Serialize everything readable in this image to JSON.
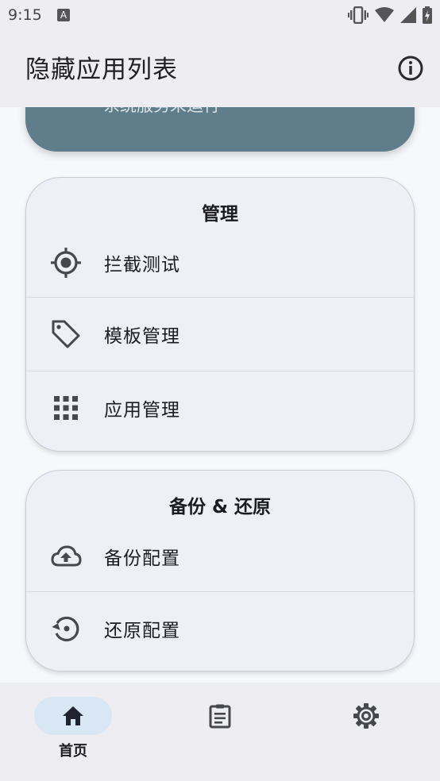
{
  "status_bar": {
    "time": "9:15",
    "notification_letter": "A"
  },
  "app_bar": {
    "title": "隐藏应用列表",
    "info_icon": "info-icon"
  },
  "status_card": {
    "partial_text": "系统服务未运行",
    "color": "#607d8b"
  },
  "manage_card": {
    "title": "管理",
    "items": [
      {
        "label": "拦截测试",
        "icon": "crosshair-icon"
      },
      {
        "label": "模板管理",
        "icon": "tag-icon"
      },
      {
        "label": "应用管理",
        "icon": "grid-icon"
      }
    ]
  },
  "backup_card": {
    "title": "备份 & 还原",
    "items": [
      {
        "label": "备份配置",
        "icon": "cloud-upload-icon"
      },
      {
        "label": "还原配置",
        "icon": "restore-icon"
      }
    ]
  },
  "bottom_nav": {
    "items": [
      {
        "label": "首页",
        "icon": "home-icon",
        "selected": true
      },
      {
        "label": "",
        "icon": "clipboard-icon",
        "selected": false
      },
      {
        "label": "",
        "icon": "settings-icon",
        "selected": false
      }
    ]
  }
}
